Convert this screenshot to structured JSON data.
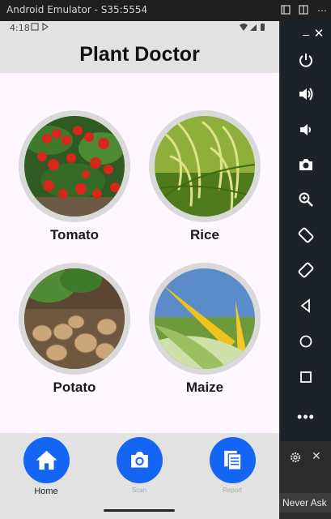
{
  "window": {
    "title": "Android Emulator - S35:5554"
  },
  "status_bar": {
    "time": "4:18"
  },
  "app": {
    "title": "Plant Doctor"
  },
  "crops": [
    {
      "label": "Tomato"
    },
    {
      "label": "Rice"
    },
    {
      "label": "Potato"
    },
    {
      "label": "Maize"
    }
  ],
  "bottom_nav": {
    "home": "Home",
    "scan": "Scan",
    "report": "Report"
  },
  "emulator_panel": {
    "never_ask": "Never Ask"
  },
  "colors": {
    "accent": "#1565f5",
    "app_background": "#fef7ff",
    "bar_background": "#e2e2e2"
  }
}
